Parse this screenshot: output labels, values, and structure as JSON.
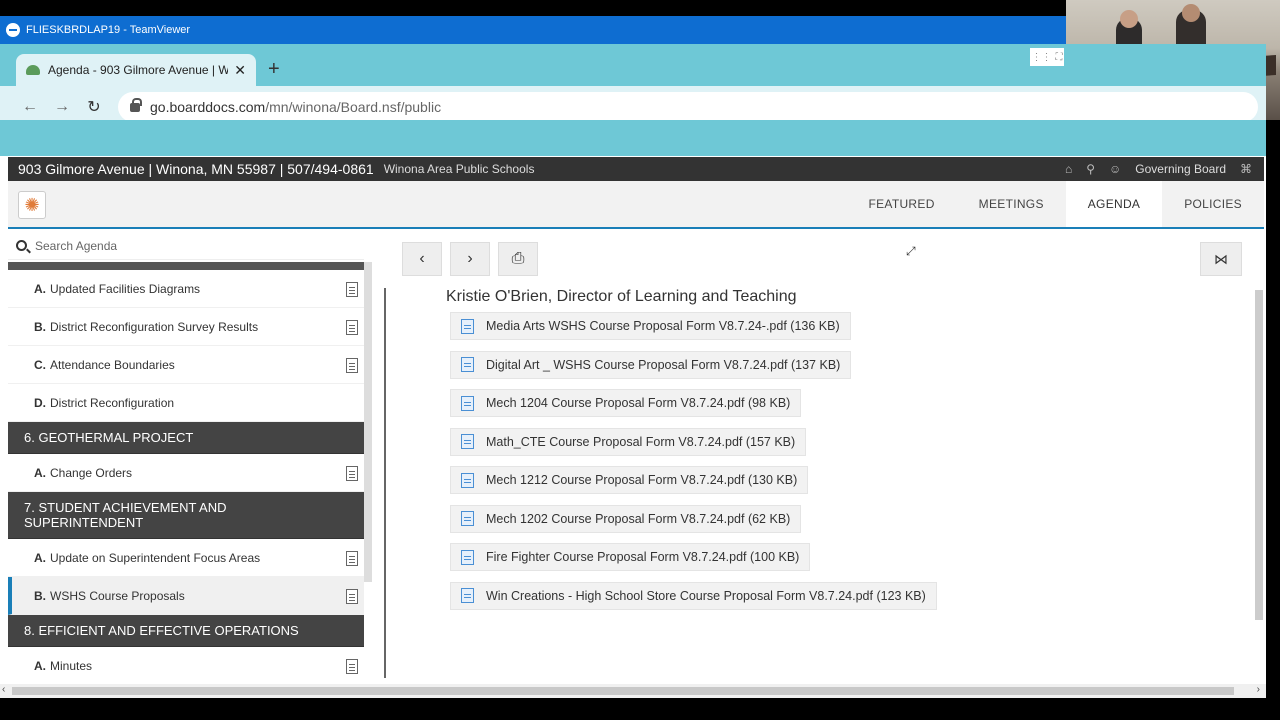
{
  "teamviewer": {
    "title": "FLIESKBRDLAP19 - TeamViewer"
  },
  "browser": {
    "tab_title": "Agenda - 903 Gilmore Avenue | W",
    "tab_close": "✕",
    "new_tab": "+",
    "url_host": "go.boarddocs.com",
    "url_path": "/mn/winona/Board.nsf/public"
  },
  "site_header": {
    "address": "903 Gilmore Avenue | Winona, MN 55987 | 507/494-0861",
    "org": "Winona Area Public Schools",
    "board": "Governing Board"
  },
  "nav": {
    "items": [
      {
        "label": "FEATURED"
      },
      {
        "label": "MEETINGS"
      },
      {
        "label": "AGENDA"
      },
      {
        "label": "POLICIES"
      }
    ],
    "active": "AGENDA"
  },
  "sidebar": {
    "search_placeholder": "Search Agenda",
    "items": [
      {
        "letter": "A.",
        "label": "Updated Facilities Diagrams"
      },
      {
        "letter": "B.",
        "label": "District Reconfiguration Survey Results"
      },
      {
        "letter": "C.",
        "label": "Attendance Boundaries"
      },
      {
        "letter": "D.",
        "label": "District Reconfiguration"
      }
    ],
    "section6": "6. GEOTHERMAL PROJECT",
    "section6_items": [
      {
        "letter": "A.",
        "label": "Change Orders"
      }
    ],
    "section7": "7. STUDENT ACHIEVEMENT AND SUPERINTENDENT",
    "section7_items": [
      {
        "letter": "A.",
        "label": "Update on Superintendent Focus Areas"
      },
      {
        "letter": "B.",
        "label": "WSHS Course Proposals"
      }
    ],
    "section8": "8. EFFICIENT AND EFFECTIVE OPERATIONS",
    "section8_items": [
      {
        "letter": "A.",
        "label": "Minutes"
      }
    ]
  },
  "content": {
    "presenter": "Kristie O'Brien, Director of Learning and Teaching",
    "files": [
      "Media Arts WSHS Course Proposal Form V8.7.24-.pdf (136 KB)",
      "Digital Art _ WSHS Course Proposal Form V8.7.24.pdf (137 KB)",
      "Mech 1204 Course Proposal Form V8.7.24.pdf (98 KB)",
      "Math_CTE Course Proposal Form V8.7.24.pdf (157 KB)",
      "Mech 1212 Course Proposal Form V8.7.24.pdf (130 KB)",
      "Mech 1202 Course Proposal Form V8.7.24.pdf (62 KB)",
      "Fire Fighter Course Proposal Form V8.7.24.pdf (100 KB)",
      "Win Creations - High School Store Course Proposal Form V8.7.24.pdf (123 KB)"
    ]
  },
  "icons": {
    "back": "←",
    "forward": "→",
    "reload": "↻",
    "prev": "‹",
    "next": "›",
    "print": "⎙",
    "share": "⋈",
    "home": "⌂",
    "search": "⚲",
    "user": "☺",
    "bank": "⌘",
    "logo": "✺",
    "resize": "⤢",
    "scroll_left": "‹",
    "scroll_right": "›"
  }
}
